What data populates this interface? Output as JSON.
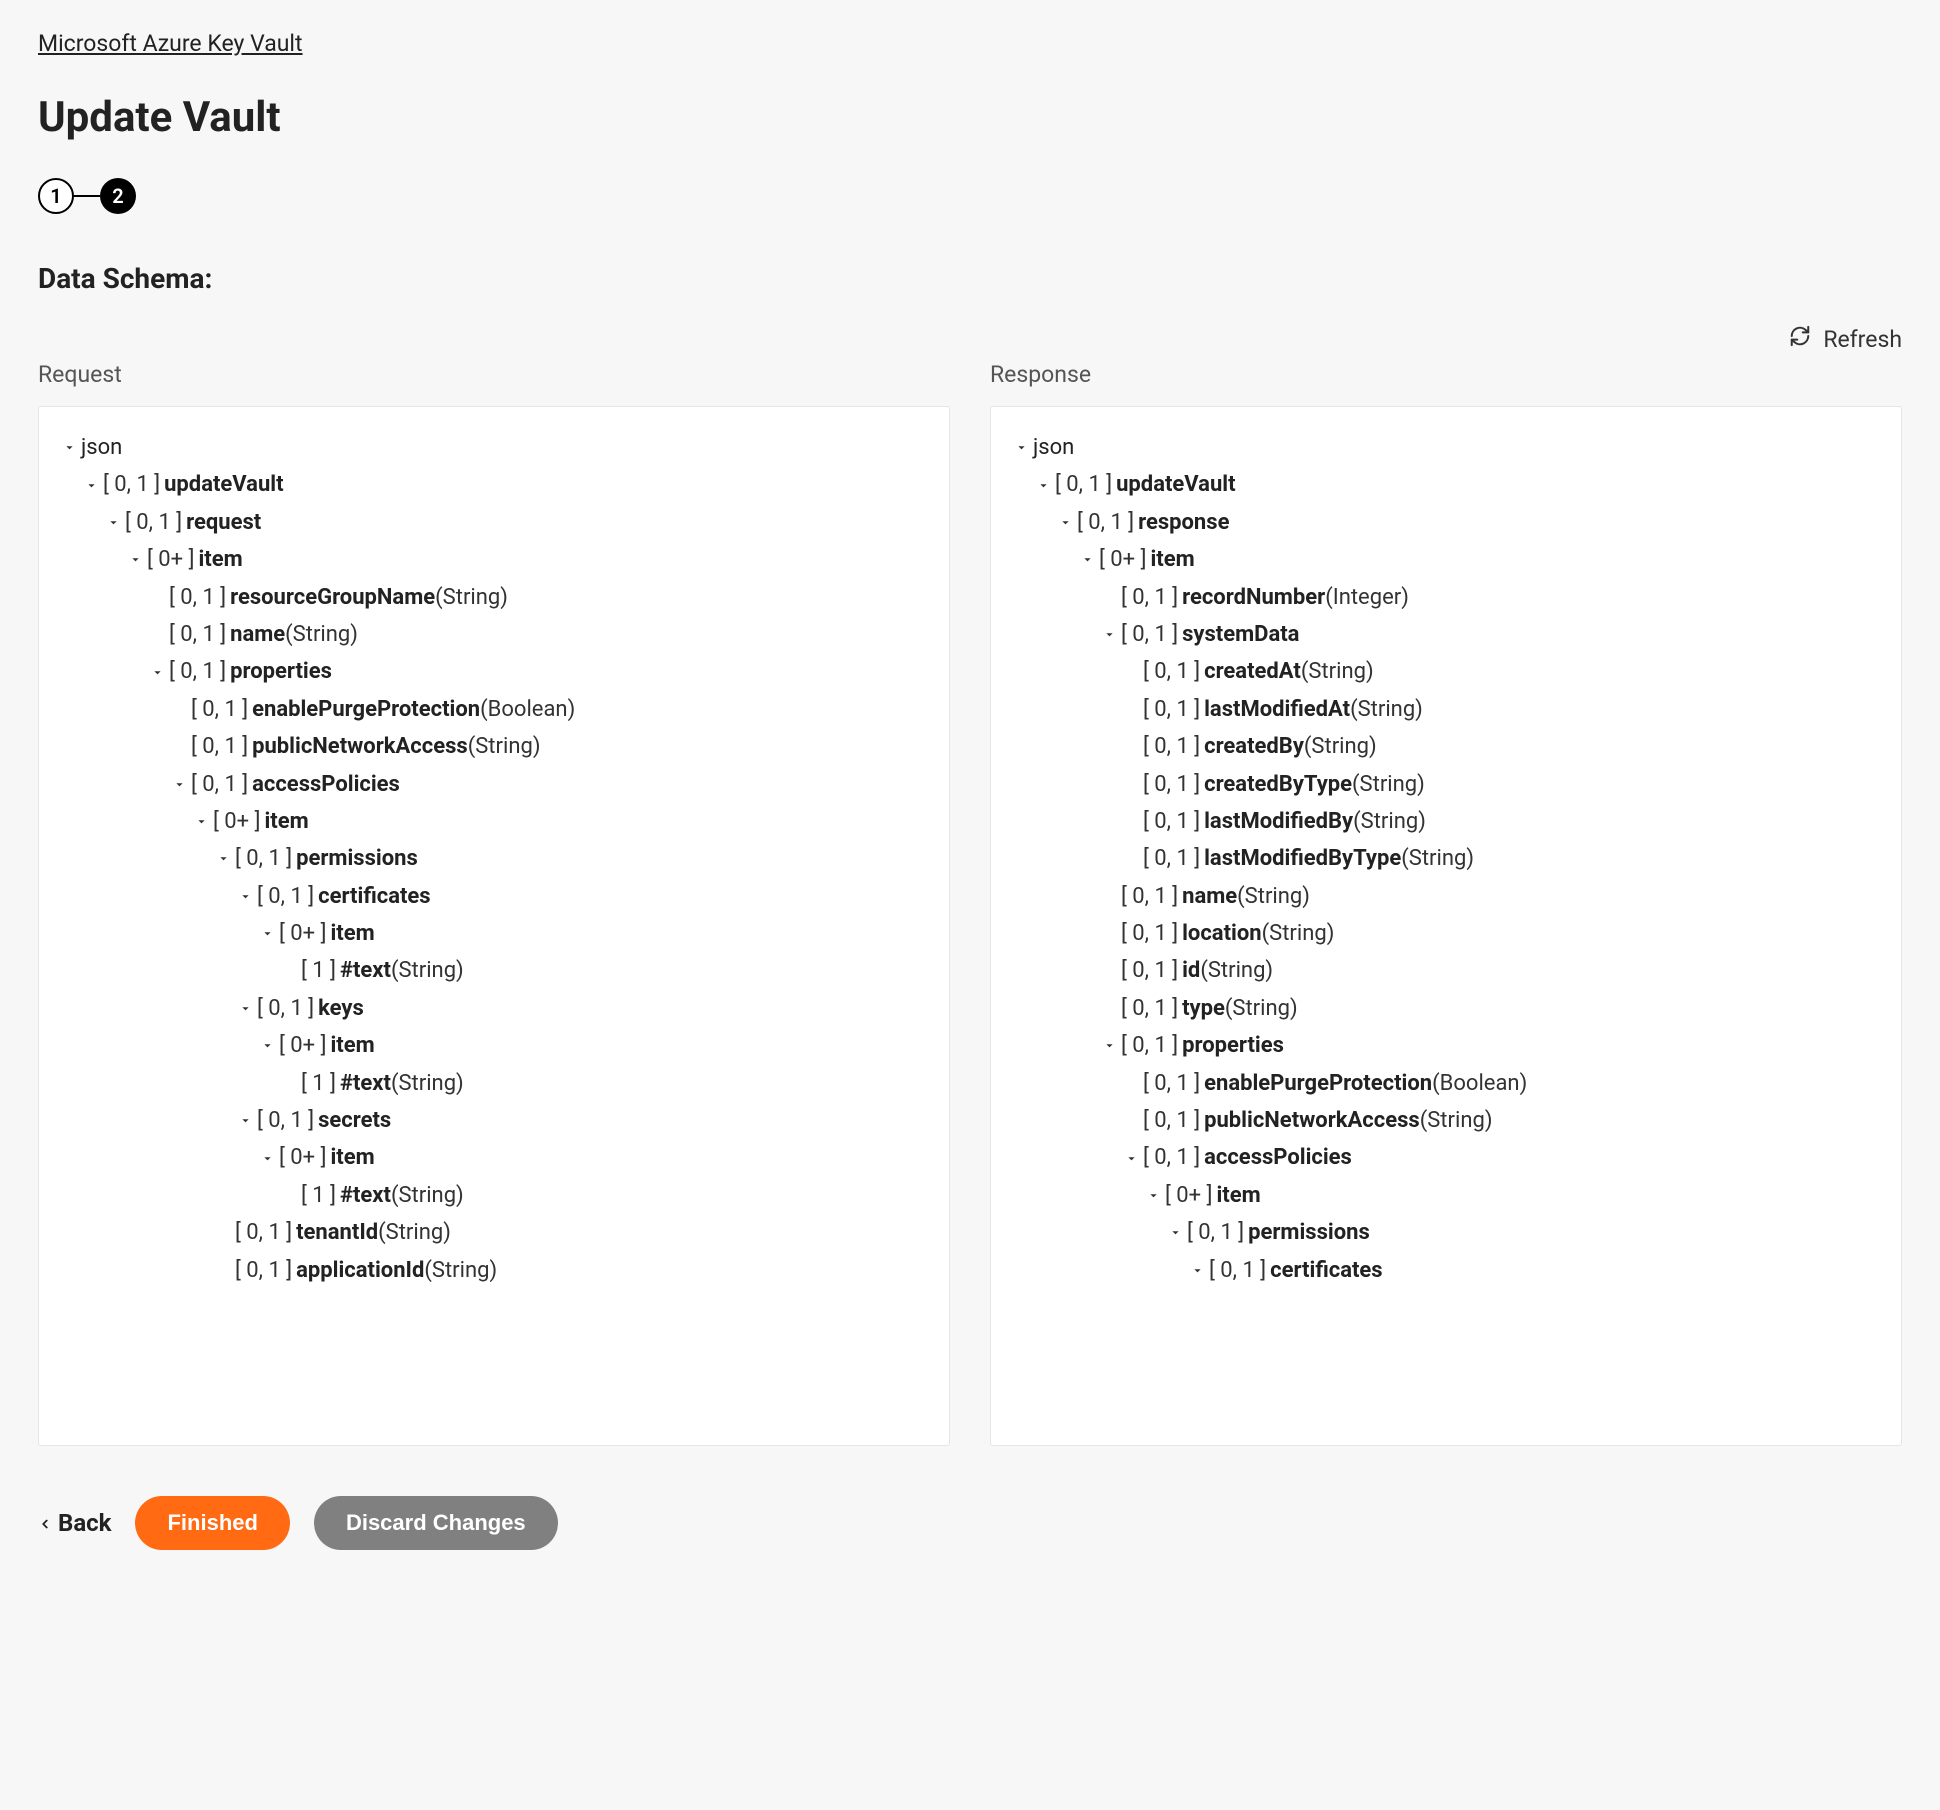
{
  "breadcrumb": "Microsoft Azure Key Vault",
  "title": "Update Vault",
  "steps": {
    "one": "1",
    "two": "2"
  },
  "section_title": "Data Schema:",
  "refresh_label": "Refresh",
  "columns": {
    "request": "Request",
    "response": "Response"
  },
  "footer": {
    "back": "Back",
    "finished": "Finished",
    "discard": "Discard Changes"
  },
  "req": [
    {
      "indent": 0,
      "chev": true,
      "card": "",
      "name": "json",
      "nameWeight": "normal",
      "type": ""
    },
    {
      "indent": 1,
      "chev": true,
      "card": "[ 0, 1 ]",
      "name": "updateVault",
      "type": ""
    },
    {
      "indent": 2,
      "chev": true,
      "card": "[ 0, 1 ]",
      "name": "request",
      "type": ""
    },
    {
      "indent": 3,
      "chev": true,
      "card": "[ 0+ ]",
      "name": "item",
      "type": ""
    },
    {
      "indent": 4,
      "chev": false,
      "card": "[ 0, 1 ]",
      "name": "resourceGroupName",
      "type": "(String)"
    },
    {
      "indent": 4,
      "chev": false,
      "card": "[ 0, 1 ]",
      "name": "name",
      "type": "(String)"
    },
    {
      "indent": 4,
      "chev": true,
      "card": "[ 0, 1 ]",
      "name": "properties",
      "type": ""
    },
    {
      "indent": 5,
      "chev": false,
      "card": "[ 0, 1 ]",
      "name": "enablePurgeProtection",
      "type": "(Boolean)"
    },
    {
      "indent": 5,
      "chev": false,
      "card": "[ 0, 1 ]",
      "name": "publicNetworkAccess",
      "type": "(String)"
    },
    {
      "indent": 5,
      "chev": true,
      "card": "[ 0, 1 ]",
      "name": "accessPolicies",
      "type": ""
    },
    {
      "indent": 6,
      "chev": true,
      "card": "[ 0+ ]",
      "name": "item",
      "type": ""
    },
    {
      "indent": 7,
      "chev": true,
      "card": "[ 0, 1 ]",
      "name": "permissions",
      "type": ""
    },
    {
      "indent": 8,
      "chev": true,
      "card": "[ 0, 1 ]",
      "name": "certificates",
      "type": ""
    },
    {
      "indent": 9,
      "chev": true,
      "card": "[ 0+ ]",
      "name": "item",
      "type": ""
    },
    {
      "indent": 10,
      "chev": false,
      "card": "[ 1 ]",
      "name": "#text",
      "type": "(String)"
    },
    {
      "indent": 8,
      "chev": true,
      "card": "[ 0, 1 ]",
      "name": "keys",
      "type": ""
    },
    {
      "indent": 9,
      "chev": true,
      "card": "[ 0+ ]",
      "name": "item",
      "type": ""
    },
    {
      "indent": 10,
      "chev": false,
      "card": "[ 1 ]",
      "name": "#text",
      "type": "(String)"
    },
    {
      "indent": 8,
      "chev": true,
      "card": "[ 0, 1 ]",
      "name": "secrets",
      "type": ""
    },
    {
      "indent": 9,
      "chev": true,
      "card": "[ 0+ ]",
      "name": "item",
      "type": ""
    },
    {
      "indent": 10,
      "chev": false,
      "card": "[ 1 ]",
      "name": "#text",
      "type": "(String)"
    },
    {
      "indent": 7,
      "chev": false,
      "card": "[ 0, 1 ]",
      "name": "tenantId",
      "type": "(String)"
    },
    {
      "indent": 7,
      "chev": false,
      "card": "[ 0, 1 ]",
      "name": "applicationId",
      "type": "(String)"
    }
  ],
  "res": [
    {
      "indent": 0,
      "chev": true,
      "card": "",
      "name": "json",
      "nameWeight": "normal",
      "type": ""
    },
    {
      "indent": 1,
      "chev": true,
      "card": "[ 0, 1 ]",
      "name": "updateVault",
      "type": ""
    },
    {
      "indent": 2,
      "chev": true,
      "card": "[ 0, 1 ]",
      "name": "response",
      "type": ""
    },
    {
      "indent": 3,
      "chev": true,
      "card": "[ 0+ ]",
      "name": "item",
      "type": ""
    },
    {
      "indent": 4,
      "chev": false,
      "card": "[ 0, 1 ]",
      "name": "recordNumber",
      "type": "(Integer)"
    },
    {
      "indent": 4,
      "chev": true,
      "card": "[ 0, 1 ]",
      "name": "systemData",
      "type": ""
    },
    {
      "indent": 5,
      "chev": false,
      "card": "[ 0, 1 ]",
      "name": "createdAt",
      "type": "(String)"
    },
    {
      "indent": 5,
      "chev": false,
      "card": "[ 0, 1 ]",
      "name": "lastModifiedAt",
      "type": "(String)"
    },
    {
      "indent": 5,
      "chev": false,
      "card": "[ 0, 1 ]",
      "name": "createdBy",
      "type": "(String)"
    },
    {
      "indent": 5,
      "chev": false,
      "card": "[ 0, 1 ]",
      "name": "createdByType",
      "type": "(String)"
    },
    {
      "indent": 5,
      "chev": false,
      "card": "[ 0, 1 ]",
      "name": "lastModifiedBy",
      "type": "(String)"
    },
    {
      "indent": 5,
      "chev": false,
      "card": "[ 0, 1 ]",
      "name": "lastModifiedByType",
      "type": "(String)"
    },
    {
      "indent": 4,
      "chev": false,
      "card": "[ 0, 1 ]",
      "name": "name",
      "type": "(String)"
    },
    {
      "indent": 4,
      "chev": false,
      "card": "[ 0, 1 ]",
      "name": "location",
      "type": "(String)"
    },
    {
      "indent": 4,
      "chev": false,
      "card": "[ 0, 1 ]",
      "name": "id",
      "type": "(String)"
    },
    {
      "indent": 4,
      "chev": false,
      "card": "[ 0, 1 ]",
      "name": "type",
      "type": "(String)"
    },
    {
      "indent": 4,
      "chev": true,
      "card": "[ 0, 1 ]",
      "name": "properties",
      "type": ""
    },
    {
      "indent": 5,
      "chev": false,
      "card": "[ 0, 1 ]",
      "name": "enablePurgeProtection",
      "type": "(Boolean)"
    },
    {
      "indent": 5,
      "chev": false,
      "card": "[ 0, 1 ]",
      "name": "publicNetworkAccess",
      "type": "(String)"
    },
    {
      "indent": 5,
      "chev": true,
      "card": "[ 0, 1 ]",
      "name": "accessPolicies",
      "type": ""
    },
    {
      "indent": 6,
      "chev": true,
      "card": "[ 0+ ]",
      "name": "item",
      "type": ""
    },
    {
      "indent": 7,
      "chev": true,
      "card": "[ 0, 1 ]",
      "name": "permissions",
      "type": ""
    },
    {
      "indent": 8,
      "chev": true,
      "card": "[ 0, 1 ]",
      "name": "certificates",
      "type": ""
    }
  ]
}
